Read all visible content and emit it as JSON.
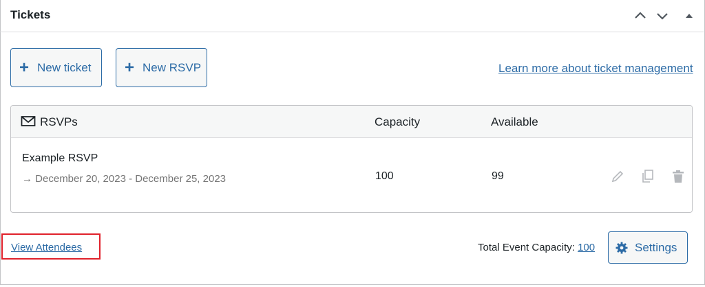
{
  "panel": {
    "title": "Tickets"
  },
  "header_controls": {
    "move_up_icon": "chevron-up-icon",
    "move_down_icon": "chevron-down-icon",
    "toggle_icon": "triangle-up-icon"
  },
  "actions": {
    "new_ticket_label": "New ticket",
    "new_rsvp_label": "New RSVP",
    "learn_more_link": "Learn more about ticket management"
  },
  "table": {
    "headers": {
      "type": "RSVPs",
      "capacity": "Capacity",
      "available": "Available"
    },
    "header_icon": "envelope-icon",
    "rows": [
      {
        "name": "Example RSVP",
        "dates": "December 20, 2023 - December 25, 2023",
        "capacity": "100",
        "available": "99"
      }
    ],
    "row_actions": [
      "pencil-icon",
      "duplicate-icon",
      "trash-icon"
    ]
  },
  "footer": {
    "view_attendees": "View Attendees",
    "capacity_label": "Total Event Capacity:",
    "capacity_value": "100",
    "settings_label": "Settings"
  },
  "colors": {
    "link_blue": "#2c6ba6",
    "highlight_red": "#e0202a",
    "border_gray": "#c3c4c7"
  }
}
